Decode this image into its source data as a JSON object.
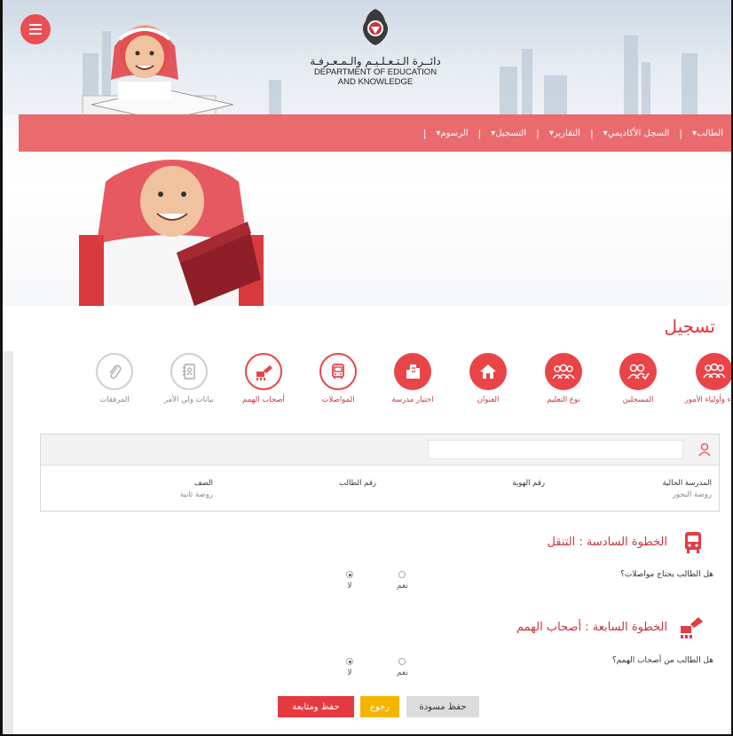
{
  "header": {
    "logo_ar": "دائــرة الـتـعـلـيـم والـمـعـرفـة",
    "logo_en_1": "DEPARTMENT OF EDUCATION",
    "logo_en_2": "AND KNOWLEDGE"
  },
  "nav": {
    "items": [
      "الطالب",
      "السجل الأكاديمي",
      "التقارير",
      "التسجيل",
      "الرسوم"
    ]
  },
  "page_title": "تسجيل",
  "steps": [
    {
      "label": "الأبناء وأولياء الأمور",
      "state": "active",
      "icon": "family-icon"
    },
    {
      "label": "المسجلين",
      "state": "active",
      "icon": "registered-icon"
    },
    {
      "label": "نوع التعليم",
      "state": "active",
      "icon": "education-type-icon"
    },
    {
      "label": "العنوان",
      "state": "active",
      "icon": "home-icon"
    },
    {
      "label": "اختيار مدرسة",
      "state": "active",
      "icon": "school-icon"
    },
    {
      "label": "المواصلات",
      "state": "current",
      "icon": "bus-icon"
    },
    {
      "label": "أصحاب الهمم",
      "state": "current",
      "icon": "wheelchair-icon"
    },
    {
      "label": "بيانات ولي الأمر",
      "state": "todo",
      "icon": "contact-book-icon"
    },
    {
      "label": "المرفقات",
      "state": "todo",
      "icon": "paperclip-icon"
    }
  ],
  "student": {
    "search_placeholder": "",
    "current_school_label": "المدرسة الحالية",
    "current_school_value": "روضة البجور",
    "id_label": "رقم الهوية",
    "student_no_label": "رقم الطالب",
    "grade_label": "الصف",
    "grade_value": "روضة ثانية"
  },
  "step6": {
    "title": "الخطوة السادسة : التنقل",
    "question": "هل الطالب يحتاج مواصلات؟",
    "yes": "نعم",
    "no": "لا",
    "selected": "no"
  },
  "step7": {
    "title": "الخطوة السابعة : أصحاب الهمم",
    "question": "هل الطالب من أصحاب الهمم؟",
    "yes": "نعم",
    "no": "لا",
    "selected": "no"
  },
  "buttons": {
    "draft": "حفظ مسودة",
    "back": "رجوع",
    "save_continue": "حفظ ومتابعة"
  },
  "colors": {
    "primary": "#e94448",
    "nav": "#ea6b6e",
    "back_button": "#f4b400"
  }
}
